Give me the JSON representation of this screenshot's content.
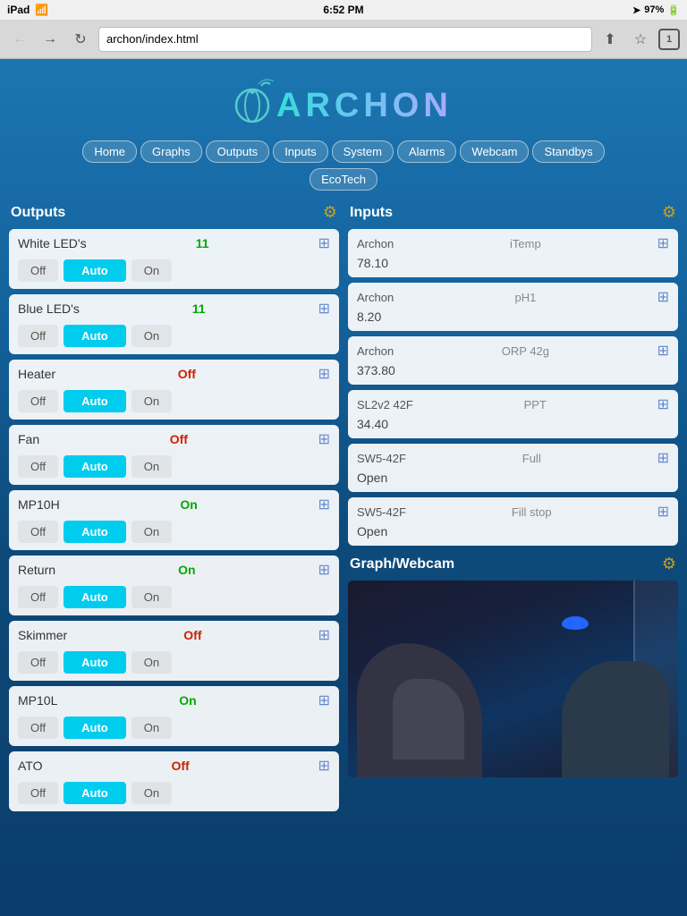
{
  "statusBar": {
    "carrier": "iPad",
    "wifi": "wifi",
    "time": "6:52 PM",
    "location": "arrow",
    "signal": "signal",
    "battery": "97%"
  },
  "browser": {
    "url": "archon/index.html",
    "tabCount": "1"
  },
  "logo": {
    "text": "ARCHON"
  },
  "nav": {
    "items": [
      "Home",
      "Graphs",
      "Outputs",
      "Inputs",
      "System",
      "Alarms",
      "Webcam",
      "Standbys"
    ],
    "items2": [
      "EcoTech"
    ]
  },
  "outputs": {
    "title": "Outputs",
    "items": [
      {
        "name": "White LED's",
        "value": "11",
        "valueType": "green",
        "btns": [
          "Off",
          "Auto",
          "On"
        ]
      },
      {
        "name": "Blue LED's",
        "value": "11",
        "valueType": "green",
        "btns": [
          "Off",
          "Auto",
          "On"
        ]
      },
      {
        "name": "Heater",
        "value": "Off",
        "valueType": "red",
        "btns": [
          "Off",
          "Auto",
          "On"
        ]
      },
      {
        "name": "Fan",
        "value": "Off",
        "valueType": "red",
        "btns": [
          "Off",
          "Auto",
          "On"
        ]
      },
      {
        "name": "MP10H",
        "value": "On",
        "valueType": "green",
        "btns": [
          "Off",
          "Auto",
          "On"
        ]
      },
      {
        "name": "Return",
        "value": "On",
        "valueType": "green",
        "btns": [
          "Off",
          "Auto",
          "On"
        ]
      },
      {
        "name": "Skimmer",
        "value": "Off",
        "valueType": "red",
        "btns": [
          "Off",
          "Auto",
          "On"
        ]
      },
      {
        "name": "MP10L",
        "value": "On",
        "valueType": "green",
        "btns": [
          "Off",
          "Auto",
          "On"
        ]
      },
      {
        "name": "ATO",
        "value": "Off",
        "valueType": "red",
        "btns": [
          "Off",
          "Auto",
          "On"
        ]
      }
    ]
  },
  "inputs": {
    "title": "Inputs",
    "items": [
      {
        "source": "Archon",
        "name": "iTemp",
        "value": "78.10"
      },
      {
        "source": "Archon",
        "name": "pH1",
        "value": "8.20"
      },
      {
        "source": "Archon",
        "name": "ORP 42g",
        "value": "373.80"
      },
      {
        "source": "SL2v2 42F",
        "name": "PPT",
        "value": "34.40"
      },
      {
        "source": "SW5-42F",
        "name": "Full",
        "value": "Open"
      },
      {
        "source": "SW5-42F",
        "name": "Fill stop",
        "value": "Open"
      }
    ]
  },
  "graphWebcam": {
    "title": "Graph/Webcam"
  }
}
